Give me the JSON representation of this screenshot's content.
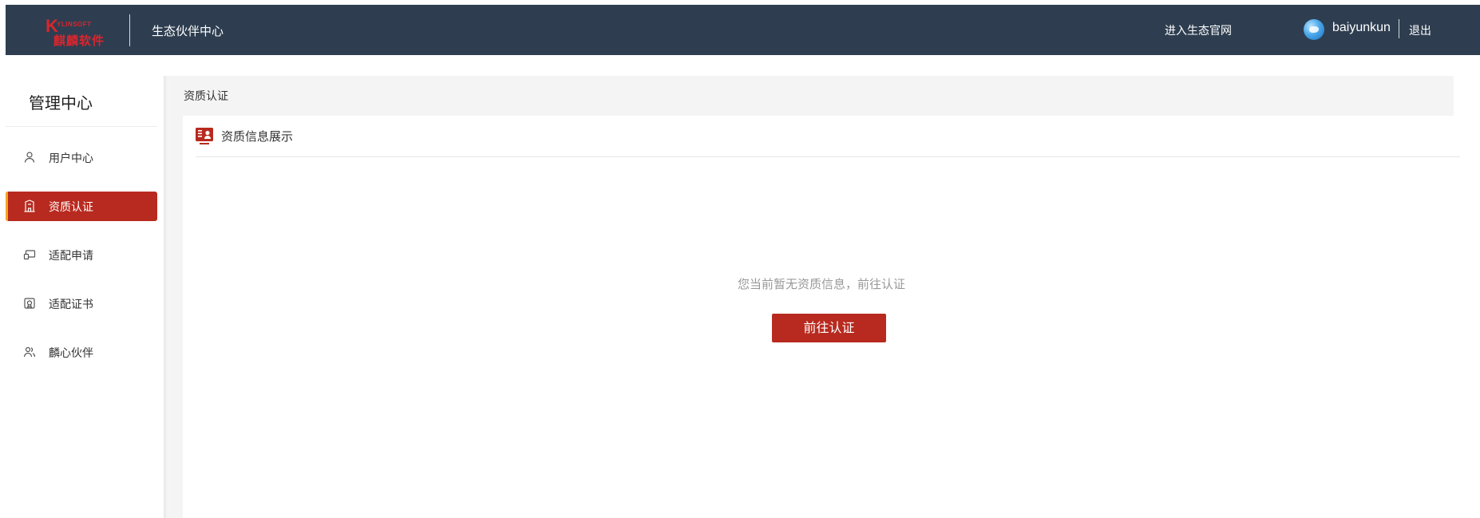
{
  "header": {
    "logo": {
      "mark": "K",
      "en_text": "YLINSOFT",
      "cn_text": "麒麟软件"
    },
    "portal_title": "生态伙伴中心",
    "eco_link": "进入生态官网",
    "user": {
      "name": "baiyunkun",
      "logout": "退出"
    }
  },
  "sidebar": {
    "title": "管理中心",
    "items": [
      {
        "label": "用户中心",
        "icon": "user-icon",
        "active": false
      },
      {
        "label": "资质认证",
        "icon": "building-icon",
        "active": true
      },
      {
        "label": "适配申请",
        "icon": "monitor-icon",
        "active": false
      },
      {
        "label": "适配证书",
        "icon": "certificate-icon",
        "active": false
      },
      {
        "label": "麟心伙伴",
        "icon": "partners-icon",
        "active": false
      }
    ]
  },
  "main": {
    "breadcrumb": "资质认证",
    "panel": {
      "title": "资质信息展示",
      "icon": "id-card-icon",
      "empty_message": "您当前暂无资质信息，前往认证",
      "button_label": "前往认证"
    }
  },
  "colors": {
    "header_bg": "#2e3e50",
    "accent_red": "#b82a1f",
    "active_marker": "#f5a623",
    "breadcrumb_bg": "#f4f4f4"
  }
}
